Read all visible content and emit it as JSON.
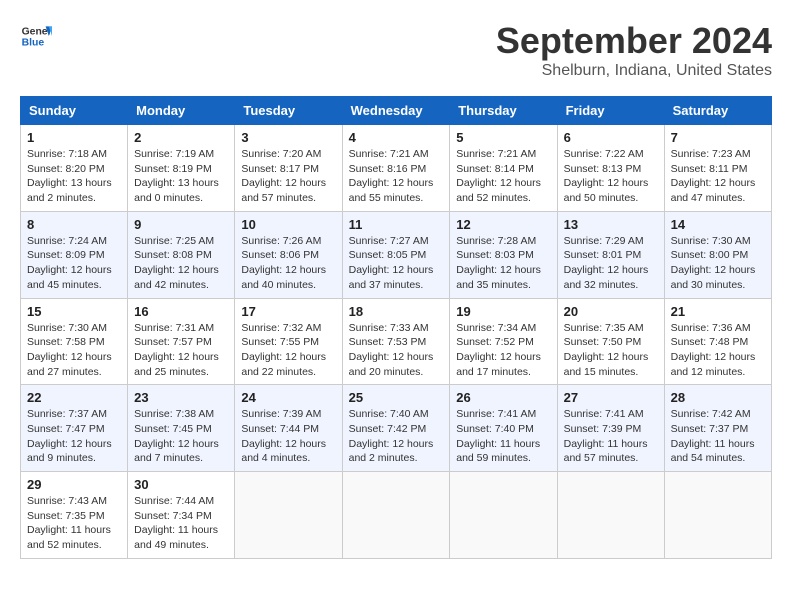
{
  "header": {
    "logo_line1": "General",
    "logo_line2": "Blue",
    "month": "September 2024",
    "location": "Shelburn, Indiana, United States"
  },
  "weekdays": [
    "Sunday",
    "Monday",
    "Tuesday",
    "Wednesday",
    "Thursday",
    "Friday",
    "Saturday"
  ],
  "weeks": [
    [
      {
        "day": "1",
        "info": "Sunrise: 7:18 AM\nSunset: 8:20 PM\nDaylight: 13 hours and 2 minutes."
      },
      {
        "day": "2",
        "info": "Sunrise: 7:19 AM\nSunset: 8:19 PM\nDaylight: 13 hours and 0 minutes."
      },
      {
        "day": "3",
        "info": "Sunrise: 7:20 AM\nSunset: 8:17 PM\nDaylight: 12 hours and 57 minutes."
      },
      {
        "day": "4",
        "info": "Sunrise: 7:21 AM\nSunset: 8:16 PM\nDaylight: 12 hours and 55 minutes."
      },
      {
        "day": "5",
        "info": "Sunrise: 7:21 AM\nSunset: 8:14 PM\nDaylight: 12 hours and 52 minutes."
      },
      {
        "day": "6",
        "info": "Sunrise: 7:22 AM\nSunset: 8:13 PM\nDaylight: 12 hours and 50 minutes."
      },
      {
        "day": "7",
        "info": "Sunrise: 7:23 AM\nSunset: 8:11 PM\nDaylight: 12 hours and 47 minutes."
      }
    ],
    [
      {
        "day": "8",
        "info": "Sunrise: 7:24 AM\nSunset: 8:09 PM\nDaylight: 12 hours and 45 minutes."
      },
      {
        "day": "9",
        "info": "Sunrise: 7:25 AM\nSunset: 8:08 PM\nDaylight: 12 hours and 42 minutes."
      },
      {
        "day": "10",
        "info": "Sunrise: 7:26 AM\nSunset: 8:06 PM\nDaylight: 12 hours and 40 minutes."
      },
      {
        "day": "11",
        "info": "Sunrise: 7:27 AM\nSunset: 8:05 PM\nDaylight: 12 hours and 37 minutes."
      },
      {
        "day": "12",
        "info": "Sunrise: 7:28 AM\nSunset: 8:03 PM\nDaylight: 12 hours and 35 minutes."
      },
      {
        "day": "13",
        "info": "Sunrise: 7:29 AM\nSunset: 8:01 PM\nDaylight: 12 hours and 32 minutes."
      },
      {
        "day": "14",
        "info": "Sunrise: 7:30 AM\nSunset: 8:00 PM\nDaylight: 12 hours and 30 minutes."
      }
    ],
    [
      {
        "day": "15",
        "info": "Sunrise: 7:30 AM\nSunset: 7:58 PM\nDaylight: 12 hours and 27 minutes."
      },
      {
        "day": "16",
        "info": "Sunrise: 7:31 AM\nSunset: 7:57 PM\nDaylight: 12 hours and 25 minutes."
      },
      {
        "day": "17",
        "info": "Sunrise: 7:32 AM\nSunset: 7:55 PM\nDaylight: 12 hours and 22 minutes."
      },
      {
        "day": "18",
        "info": "Sunrise: 7:33 AM\nSunset: 7:53 PM\nDaylight: 12 hours and 20 minutes."
      },
      {
        "day": "19",
        "info": "Sunrise: 7:34 AM\nSunset: 7:52 PM\nDaylight: 12 hours and 17 minutes."
      },
      {
        "day": "20",
        "info": "Sunrise: 7:35 AM\nSunset: 7:50 PM\nDaylight: 12 hours and 15 minutes."
      },
      {
        "day": "21",
        "info": "Sunrise: 7:36 AM\nSunset: 7:48 PM\nDaylight: 12 hours and 12 minutes."
      }
    ],
    [
      {
        "day": "22",
        "info": "Sunrise: 7:37 AM\nSunset: 7:47 PM\nDaylight: 12 hours and 9 minutes."
      },
      {
        "day": "23",
        "info": "Sunrise: 7:38 AM\nSunset: 7:45 PM\nDaylight: 12 hours and 7 minutes."
      },
      {
        "day": "24",
        "info": "Sunrise: 7:39 AM\nSunset: 7:44 PM\nDaylight: 12 hours and 4 minutes."
      },
      {
        "day": "25",
        "info": "Sunrise: 7:40 AM\nSunset: 7:42 PM\nDaylight: 12 hours and 2 minutes."
      },
      {
        "day": "26",
        "info": "Sunrise: 7:41 AM\nSunset: 7:40 PM\nDaylight: 11 hours and 59 minutes."
      },
      {
        "day": "27",
        "info": "Sunrise: 7:41 AM\nSunset: 7:39 PM\nDaylight: 11 hours and 57 minutes."
      },
      {
        "day": "28",
        "info": "Sunrise: 7:42 AM\nSunset: 7:37 PM\nDaylight: 11 hours and 54 minutes."
      }
    ],
    [
      {
        "day": "29",
        "info": "Sunrise: 7:43 AM\nSunset: 7:35 PM\nDaylight: 11 hours and 52 minutes."
      },
      {
        "day": "30",
        "info": "Sunrise: 7:44 AM\nSunset: 7:34 PM\nDaylight: 11 hours and 49 minutes."
      },
      {
        "day": "",
        "info": ""
      },
      {
        "day": "",
        "info": ""
      },
      {
        "day": "",
        "info": ""
      },
      {
        "day": "",
        "info": ""
      },
      {
        "day": "",
        "info": ""
      }
    ]
  ]
}
